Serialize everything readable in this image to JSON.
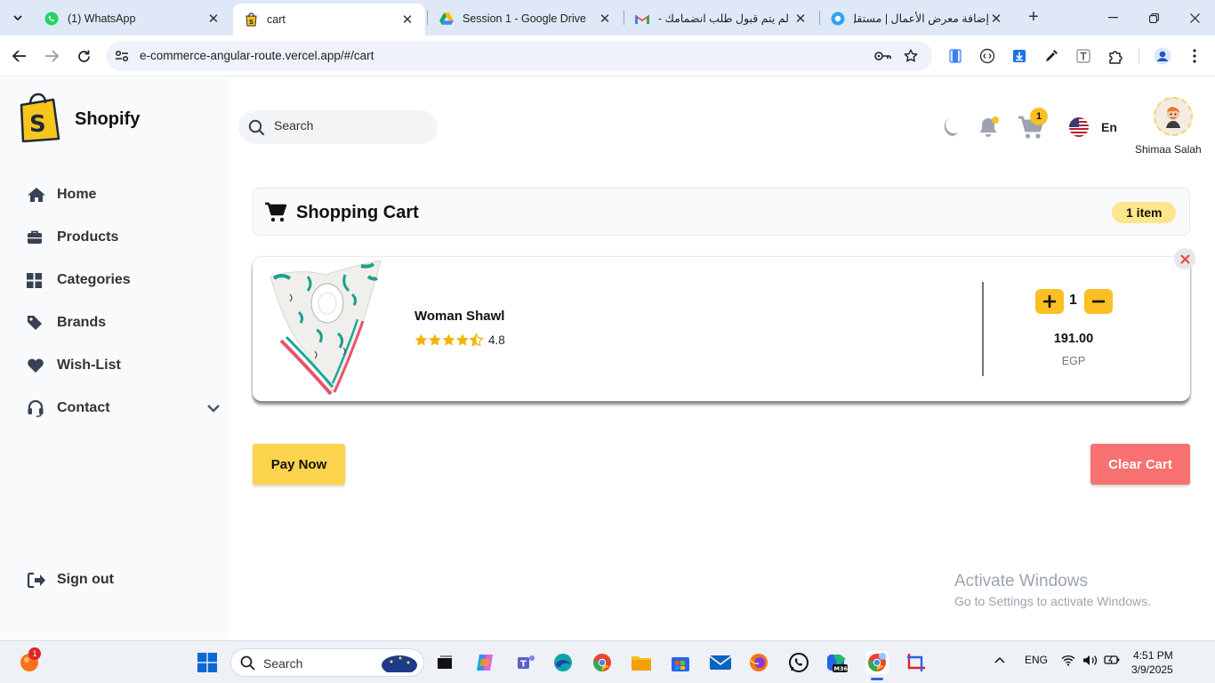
{
  "browser": {
    "tabs": [
      {
        "title": "(1) WhatsApp",
        "icon": "whatsapp-icon"
      },
      {
        "title": "cart",
        "icon": "shopify-icon",
        "active": true
      },
      {
        "title": "Session 1 - Google Drive",
        "icon": "google-drive-icon"
      },
      {
        "title": "لم يتم قبول طلب انضمامك -",
        "icon": "gmail-icon"
      },
      {
        "title": "إضافة معرض الأعمال | مستقل",
        "icon": "mostaql-icon"
      }
    ],
    "url": "e-commerce-angular-route.vercel.app/#/cart"
  },
  "sidebar": {
    "logo_text": "Shopify",
    "items": [
      {
        "label": "Home",
        "icon": "home-icon"
      },
      {
        "label": "Products",
        "icon": "briefcase-icon"
      },
      {
        "label": "Categories",
        "icon": "grid-icon"
      },
      {
        "label": "Brands",
        "icon": "tag-icon"
      },
      {
        "label": "Wish-List",
        "icon": "heart-icon"
      },
      {
        "label": "Contact",
        "icon": "headset-icon"
      }
    ],
    "signout_label": "Sign out"
  },
  "header": {
    "search_placeholder": "Search",
    "cart_count": "1",
    "language": "En",
    "user_name": "Shimaa Salah"
  },
  "cart": {
    "title": "Shopping Cart",
    "count_badge": "1 item",
    "items": [
      {
        "name": "Woman Shawl",
        "rating": "4.8",
        "quantity": "1",
        "price": "191.00",
        "currency": "EGP"
      }
    ],
    "pay_label": "Pay Now",
    "clear_label": "Clear Cart"
  },
  "watermark": {
    "line1": "Activate Windows",
    "line2": "Go to Settings to activate Windows."
  },
  "taskbar": {
    "search_placeholder": "Search",
    "notification_count": "1",
    "language": "ENG",
    "time": "4:51 PM",
    "date": "3/9/2025"
  },
  "colors": {
    "accent_yellow": "#fbbf24",
    "danger_red": "#f87171",
    "sidebar_bg": "#f9fafb"
  }
}
